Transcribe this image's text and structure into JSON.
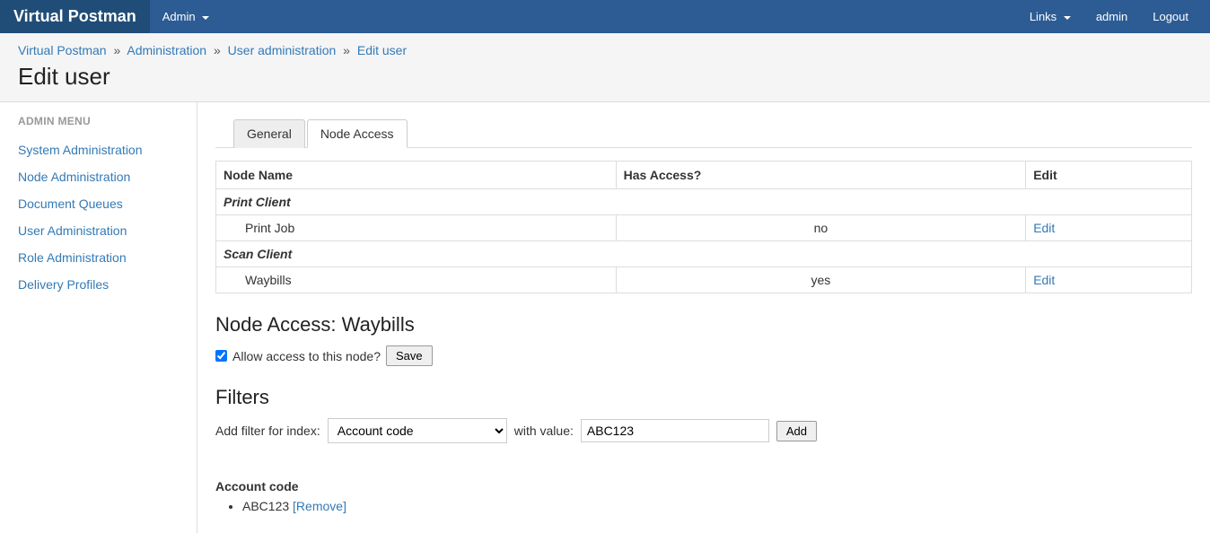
{
  "brand": "Virtual Postman",
  "nav": {
    "admin": "Admin",
    "links": "Links",
    "user": "admin",
    "logout": "Logout"
  },
  "breadcrumbs": {
    "items": [
      "Virtual Postman",
      "Administration",
      "User administration",
      "Edit user"
    ],
    "sep": "»"
  },
  "page_title": "Edit user",
  "sidebar": {
    "header": "ADMIN MENU",
    "items": [
      "System Administration",
      "Node Administration",
      "Document Queues",
      "User Administration",
      "Role Administration",
      "Delivery Profiles"
    ]
  },
  "tabs": {
    "general": "General",
    "node_access": "Node Access"
  },
  "table": {
    "headers": {
      "node_name": "Node Name",
      "has_access": "Has Access?",
      "edit": "Edit"
    },
    "group1": {
      "name": "Print Client",
      "child": {
        "name": "Print Job",
        "access": "no",
        "edit": "Edit"
      }
    },
    "group2": {
      "name": "Scan Client",
      "child": {
        "name": "Waybills",
        "access": "yes",
        "edit": "Edit"
      }
    }
  },
  "node_access_section": {
    "title": "Node Access: Waybills",
    "checkbox_label": "Allow access to this node?",
    "checkbox_checked": true,
    "save": "Save"
  },
  "filters": {
    "title": "Filters",
    "label_prefix": "Add filter for index:",
    "label_value": "with value:",
    "select_value": "Account code",
    "input_value": "ABC123",
    "add": "Add"
  },
  "applied_filters": {
    "group_title": "Account code",
    "items": [
      {
        "value": "ABC123",
        "remove": "[Remove]"
      }
    ]
  }
}
